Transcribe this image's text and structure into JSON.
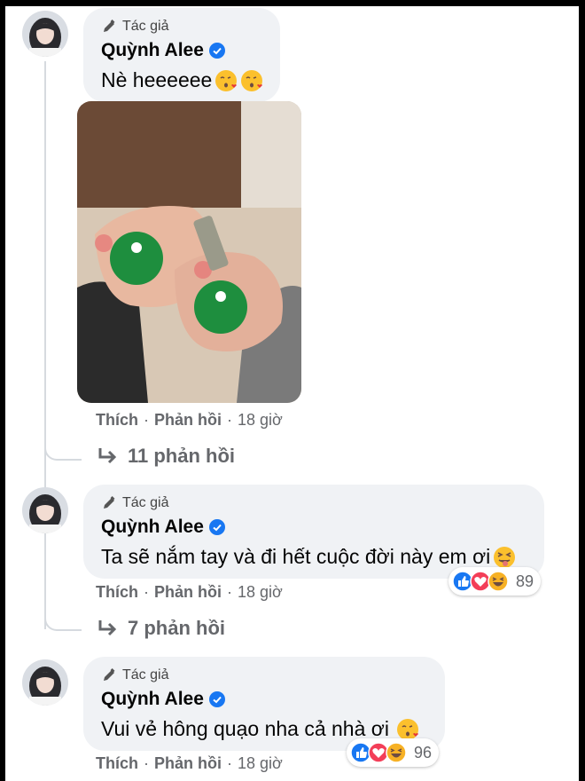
{
  "comments": [
    {
      "badge": "Tác giả",
      "author": "Quỳnh Alee",
      "text": "Nè heeeeee",
      "emojis": [
        "kissing-heart-emoji",
        "kissing-heart-emoji"
      ],
      "actions": {
        "like": "Thích",
        "sep": "·",
        "reply": "Phản hồi",
        "time": "18 giờ"
      },
      "reply_count_label": "11 phản hồi",
      "has_photo": true
    },
    {
      "badge": "Tác giả",
      "author": "Quỳnh Alee",
      "text": "Ta sẽ nắm tay và đi hết cuộc đời này em ơi",
      "emojis": [
        "squinting-tongue-emoji"
      ],
      "actions": {
        "like": "Thích",
        "sep": "·",
        "reply": "Phản hồi",
        "time": "18 giờ"
      },
      "reactions": {
        "icons": [
          "like",
          "love",
          "haha"
        ],
        "count": "89"
      },
      "reply_count_label": "7 phản hồi"
    },
    {
      "badge": "Tác giả",
      "author": "Quỳnh Alee",
      "text": "Vui vẻ hông quạo nha cả nhà ơi",
      "emojis": [
        "kissing-heart-emoji"
      ],
      "actions": {
        "like": "Thích",
        "sep": "·",
        "reply": "Phản hồi",
        "time": "18 giờ"
      },
      "reactions": {
        "icons": [
          "like",
          "love",
          "haha"
        ],
        "count": "96"
      }
    }
  ],
  "colors": {
    "bubble": "#f0f2f5",
    "meta": "#65676b",
    "verified": "#1877f2",
    "like": "#1877f2",
    "love": "#f33e58",
    "haha": "#f7b125"
  }
}
